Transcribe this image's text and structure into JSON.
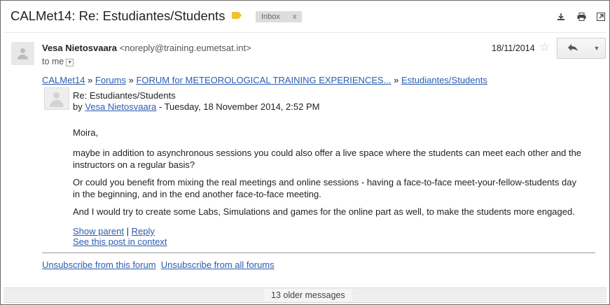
{
  "email": {
    "subject": "CALMet14: Re: Estudiantes/Students",
    "label_chip": "Inbox",
    "label_chip_close": "x",
    "sender_name": "Vesa Nietosvaara",
    "sender_email": "<noreply@training.eumetsat.int>",
    "recipient": "to me",
    "date": "18/11/2014"
  },
  "breadcrumb": {
    "items": [
      "CALMet14",
      "Forums",
      "FORUM for METEOROLOGICAL TRAINING EXPERIENCES...",
      "Estudiantes/Students"
    ],
    "separator": "»"
  },
  "post": {
    "title": "Re: Estudiantes/Students",
    "by_prefix": "by",
    "author": "Vesa Nietosvaara",
    "datetime": "- Tuesday, 18 November 2014, 2:52 PM",
    "greeting": "Moira,",
    "paragraphs": [
      "maybe in addition to asynchronous sessions you could also offer a live space where the students can meet each other and the instructors on a regular basis?",
      "Or could you benefit from mixing the real meetings and online sessions - having a face-to-face meet-your-fellow-students day in the beginning, and in the end another face-to-face meeting.",
      "And I would try to create some Labs, Simulations and games for the online part as well, to make the students more engaged."
    ],
    "show_parent": "Show parent",
    "action_sep": "|",
    "reply": "Reply",
    "see_in_context": "See this post in context"
  },
  "footer": {
    "unsubscribe_forum": "Unsubscribe from this forum",
    "unsubscribe_all": "Unsubscribe from all forums"
  },
  "thread": {
    "older_messages": "13 older messages"
  },
  "icons": {
    "label": "label-tag-icon",
    "download": "download-icon",
    "print": "print-icon",
    "new_window": "new-window-icon",
    "star": "star-icon",
    "reply": "reply-arrow-icon",
    "more": "chevron-down-icon",
    "avatar": "avatar-placeholder-icon"
  },
  "colors": {
    "link": "#2a5db0",
    "label_yellow": "#f2c12e",
    "chip_bg": "#dddddd"
  }
}
